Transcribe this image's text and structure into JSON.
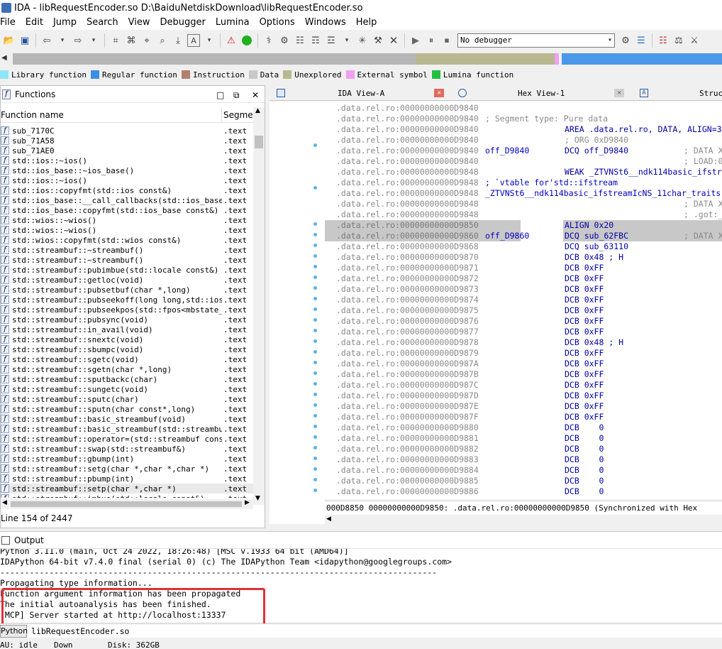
{
  "window": {
    "title": "IDA - libRequestEncoder.so D:\\BaiduNetdiskDownload\\libRequestEncoder.so"
  },
  "menu": [
    "File",
    "Edit",
    "Jump",
    "Search",
    "View",
    "Debugger",
    "Lumina",
    "Options",
    "Windows",
    "Help"
  ],
  "toolbar": {
    "debugger_value": "No debugger"
  },
  "legend": [
    {
      "label": "Library function",
      "color": "#8ee6f8"
    },
    {
      "label": "Regular function",
      "color": "#3a8ee6"
    },
    {
      "label": "Instruction",
      "color": "#b38070"
    },
    {
      "label": "Data",
      "color": "#c8c8c8"
    },
    {
      "label": "Unexplored",
      "color": "#b8b890"
    },
    {
      "label": "External symbol",
      "color": "#f0a0f0"
    },
    {
      "label": "Lumina function",
      "color": "#22c040"
    }
  ],
  "functions_panel": {
    "title": "Functions",
    "col_name": "Function name",
    "col_segment": "Segme",
    "line_count": "Line 154 of 2447",
    "rows": [
      {
        "name": "sub_7170C",
        "seg": ".text"
      },
      {
        "name": "sub_71A58",
        "seg": ".text"
      },
      {
        "name": "sub_71AE0",
        "seg": ".text"
      },
      {
        "name": "std::ios::~ios()",
        "seg": ".text"
      },
      {
        "name": "std::ios_base::~ios_base()",
        "seg": ".text"
      },
      {
        "name": "std::ios::~ios()",
        "seg": ".text"
      },
      {
        "name": "std::ios::copyfmt(std::ios const&)",
        "seg": ".text"
      },
      {
        "name": "std::ios_base::__call_callbacks(std::ios_base::",
        "seg": ".text"
      },
      {
        "name": "std::ios_base::copyfmt(std::ios_base const&)",
        "seg": ".text"
      },
      {
        "name": "std::wios::~wios()",
        "seg": ".text"
      },
      {
        "name": "std::wios::~wios()",
        "seg": ".text"
      },
      {
        "name": "std::wios::copyfmt(std::wios const&)",
        "seg": ".text"
      },
      {
        "name": "std::streambuf::~streambuf()",
        "seg": ".text"
      },
      {
        "name": "std::streambuf::~streambuf()",
        "seg": ".text"
      },
      {
        "name": "std::streambuf::pubimbue(std::locale const&)",
        "seg": ".text"
      },
      {
        "name": "std::streambuf::getloc(void)",
        "seg": ".text"
      },
      {
        "name": "std::streambuf::pubsetbuf(char *,long)",
        "seg": ".text"
      },
      {
        "name": "std::streambuf::pubseekoff(long long,std::ios_",
        "seg": ".text"
      },
      {
        "name": "std::streambuf::pubseekpos(std::fpos<mbstate_t",
        "seg": ".text"
      },
      {
        "name": "std::streambuf::pubsync(void)",
        "seg": ".text"
      },
      {
        "name": "std::streambuf::in_avail(void)",
        "seg": ".text"
      },
      {
        "name": "std::streambuf::snextc(void)",
        "seg": ".text"
      },
      {
        "name": "std::streambuf::sbumpc(void)",
        "seg": ".text"
      },
      {
        "name": "std::streambuf::sgetc(void)",
        "seg": ".text"
      },
      {
        "name": "std::streambuf::sgetn(char *,long)",
        "seg": ".text"
      },
      {
        "name": "std::streambuf::sputbackc(char)",
        "seg": ".text"
      },
      {
        "name": "std::streambuf::sungetc(void)",
        "seg": ".text"
      },
      {
        "name": "std::streambuf::sputc(char)",
        "seg": ".text"
      },
      {
        "name": "std::streambuf::sputn(char const*,long)",
        "seg": ".text"
      },
      {
        "name": "std::streambuf::basic_streambuf(void)",
        "seg": ".text"
      },
      {
        "name": "std::streambuf::basic_streambuf(std::streambuf",
        "seg": ".text"
      },
      {
        "name": "std::streambuf::operator=(std::streambuf const&)",
        "seg": ".text"
      },
      {
        "name": "std::streambuf::swap(std::streambuf&)",
        "seg": ".text"
      },
      {
        "name": "std::streambuf::gbump(int)",
        "seg": ".text"
      },
      {
        "name": "std::streambuf::setg(char *,char *,char *)",
        "seg": ".text"
      },
      {
        "name": "std::streambuf::pbump(int)",
        "seg": ".text"
      },
      {
        "name": "std::streambuf::setp(char *,char *)",
        "seg": ".text"
      },
      {
        "name": "std::streambuf::imbue(std::locale const&)",
        "seg": ".text"
      }
    ]
  },
  "tabs": [
    {
      "label": "IDA View-A",
      "active": true
    },
    {
      "label": "Hex View-1",
      "active": false
    },
    {
      "label": "Struc",
      "active": false
    }
  ],
  "disasm_lines": [
    {
      "addr": ".data.rel.ro:00000000000D9840",
      "label": "",
      "text": "",
      "comment": ""
    },
    {
      "addr": ".data.rel.ro:00000000000D9840",
      "label": "",
      "text": "; Segment type: Pure data",
      "comment": "",
      "full": true
    },
    {
      "addr": ".data.rel.ro:00000000000D9840",
      "label": "",
      "text": "AREA .data.rel.ro, DATA, ALIGN=3",
      "comment": ""
    },
    {
      "addr": ".data.rel.ro:00000000000D9840",
      "label": "",
      "text": "; ORG 0xD9840",
      "comment": "",
      "gray": true
    },
    {
      "addr": ".data.rel.ro:00000000000D9840",
      "label": "off_D9840",
      "text": "DCQ off_D9840",
      "comment": "; DATA X"
    },
    {
      "addr": ".data.rel.ro:00000000000D9840",
      "label": "",
      "text": "",
      "comment": "; LOAD:0"
    },
    {
      "addr": ".data.rel.ro:00000000000D9848",
      "label": "",
      "text": "WEAK _ZTVNSt6__ndk114basic_ifstr",
      "comment": ""
    },
    {
      "addr": ".data.rel.ro:00000000000D9848",
      "label": "",
      "text": "; `vtable for'std::ifstream",
      "comment": "",
      "full": true,
      "blue": true
    },
    {
      "addr": ".data.rel.ro:00000000000D9848",
      "label": "",
      "text": "_ZTVNSt6__ndk114basic_ifstreamIcNS_11char_traits",
      "comment": "",
      "full": true,
      "blue": true
    },
    {
      "addr": ".data.rel.ro:00000000000D9848",
      "label": "",
      "text": "",
      "comment": "; DATA X"
    },
    {
      "addr": ".data.rel.ro:00000000000D9848",
      "label": "",
      "text": "",
      "comment": "; .got:_"
    },
    {
      "addr": ".data.rel.ro:00000000000D9850",
      "label": "",
      "text": "ALIGN 0x20",
      "comment": "",
      "hl": true
    },
    {
      "addr": ".data.rel.ro:00000000000D9860",
      "label": "off_D9860",
      "text": "DCQ sub_62FBC",
      "comment": "; DATA X",
      "hl": true
    },
    {
      "addr": ".data.rel.ro:00000000000D9868",
      "label": "",
      "text": "DCQ sub_63110",
      "comment": ""
    },
    {
      "addr": ".data.rel.ro:00000000000D9870",
      "label": "",
      "text": "DCB 0x48 ; H",
      "comment": ""
    },
    {
      "addr": ".data.rel.ro:00000000000D9871",
      "label": "",
      "text": "DCB 0xFF",
      "comment": ""
    },
    {
      "addr": ".data.rel.ro:00000000000D9872",
      "label": "",
      "text": "DCB 0xFF",
      "comment": ""
    },
    {
      "addr": ".data.rel.ro:00000000000D9873",
      "label": "",
      "text": "DCB 0xFF",
      "comment": ""
    },
    {
      "addr": ".data.rel.ro:00000000000D9874",
      "label": "",
      "text": "DCB 0xFF",
      "comment": ""
    },
    {
      "addr": ".data.rel.ro:00000000000D9875",
      "label": "",
      "text": "DCB 0xFF",
      "comment": ""
    },
    {
      "addr": ".data.rel.ro:00000000000D9876",
      "label": "",
      "text": "DCB 0xFF",
      "comment": ""
    },
    {
      "addr": ".data.rel.ro:00000000000D9877",
      "label": "",
      "text": "DCB 0xFF",
      "comment": ""
    },
    {
      "addr": ".data.rel.ro:00000000000D9878",
      "label": "",
      "text": "DCB 0x48 ; H",
      "comment": ""
    },
    {
      "addr": ".data.rel.ro:00000000000D9879",
      "label": "",
      "text": "DCB 0xFF",
      "comment": ""
    },
    {
      "addr": ".data.rel.ro:00000000000D987A",
      "label": "",
      "text": "DCB 0xFF",
      "comment": ""
    },
    {
      "addr": ".data.rel.ro:00000000000D987B",
      "label": "",
      "text": "DCB 0xFF",
      "comment": ""
    },
    {
      "addr": ".data.rel.ro:00000000000D987C",
      "label": "",
      "text": "DCB 0xFF",
      "comment": ""
    },
    {
      "addr": ".data.rel.ro:00000000000D987D",
      "label": "",
      "text": "DCB 0xFF",
      "comment": ""
    },
    {
      "addr": ".data.rel.ro:00000000000D987E",
      "label": "",
      "text": "DCB 0xFF",
      "comment": ""
    },
    {
      "addr": ".data.rel.ro:00000000000D987F",
      "label": "",
      "text": "DCB 0xFF",
      "comment": ""
    },
    {
      "addr": ".data.rel.ro:00000000000D9880",
      "label": "",
      "text": "DCB    0",
      "comment": ""
    },
    {
      "addr": ".data.rel.ro:00000000000D9881",
      "label": "",
      "text": "DCB    0",
      "comment": ""
    },
    {
      "addr": ".data.rel.ro:00000000000D9882",
      "label": "",
      "text": "DCB    0",
      "comment": ""
    },
    {
      "addr": ".data.rel.ro:00000000000D9883",
      "label": "",
      "text": "DCB    0",
      "comment": ""
    },
    {
      "addr": ".data.rel.ro:00000000000D9884",
      "label": "",
      "text": "DCB    0",
      "comment": ""
    },
    {
      "addr": ".data.rel.ro:00000000000D9885",
      "label": "",
      "text": "DCB    0",
      "comment": ""
    },
    {
      "addr": ".data.rel.ro:00000000000D9886",
      "label": "",
      "text": "DCB    0",
      "comment": ""
    }
  ],
  "disasm_status": "000D8850 00000000000D9850: .data.rel.ro:00000000000D9850 (Synchronized with Hex",
  "output": {
    "title": "Output",
    "lines": [
      "Python 3.11.0 (main, Oct 24 2022, 18:26:48) [MSC v.1933 64 bit (AMD64)]",
      "IDAPython 64-bit v7.4.0 final (serial 0) (c) The IDAPython Team <idapython@googlegroups.com>",
      "-----------------------------------------------------------------------------------------",
      "Propagating type information...",
      "Function argument information has been propagated",
      "The initial autoanalysis has been finished.",
      "[MCP] Server started at http://localhost:13337"
    ],
    "cmd_lang": "Python",
    "cmd_text": "libRequestEncoder.so"
  },
  "status": {
    "state": "AU:  idle",
    "dir": "Down",
    "disk": "Disk: 362GB"
  }
}
